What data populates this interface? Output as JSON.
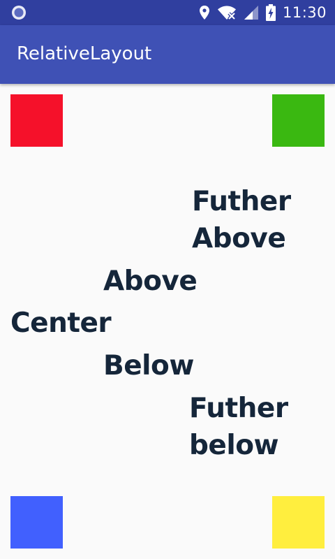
{
  "status_bar": {
    "time": "11:30",
    "background": "#303f9f"
  },
  "app_bar": {
    "title": "RelativeLayout",
    "background": "#3f51b5"
  },
  "squares": {
    "top_left": "#f5112a",
    "top_right": "#3ab811",
    "bottom_left": "#4160fe",
    "bottom_right": "#ffee3e"
  },
  "labels": {
    "further_above_line1": "Futher",
    "further_above_line2": "Above",
    "above": "Above",
    "center": "Center",
    "below": "Below",
    "further_below_line1": "Futher",
    "further_below_line2": "below"
  },
  "icons": {
    "status_left": "app-notification-icon",
    "location": "location-icon",
    "wifi": "wifi-off-icon",
    "signal": "signal-icon",
    "battery": "battery-charging-icon"
  }
}
